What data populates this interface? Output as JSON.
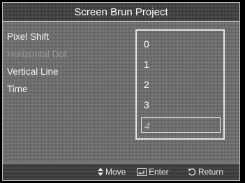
{
  "window": {
    "title": "Screen Brun Project"
  },
  "menu": {
    "items": [
      {
        "label": "Pixel Shift",
        "enabled": true
      },
      {
        "label": "Horizontal Dot",
        "enabled": false
      },
      {
        "label": "Vertical Line",
        "enabled": true
      },
      {
        "label": "Time",
        "enabled": true
      }
    ]
  },
  "options": {
    "values": [
      "0",
      "1",
      "2",
      "3",
      "4"
    ],
    "selected_index": 4
  },
  "footer": {
    "move_label": "Move",
    "enter_label": "Enter",
    "return_label": "Return",
    "icons": [
      "updown-arrow-icon",
      "enter-icon",
      "return-icon"
    ]
  },
  "colors": {
    "panel": "#6c6c6c",
    "bar": "#3b3b3b",
    "text": "#ffffff",
    "disabled_text": "#9a9a9a"
  }
}
